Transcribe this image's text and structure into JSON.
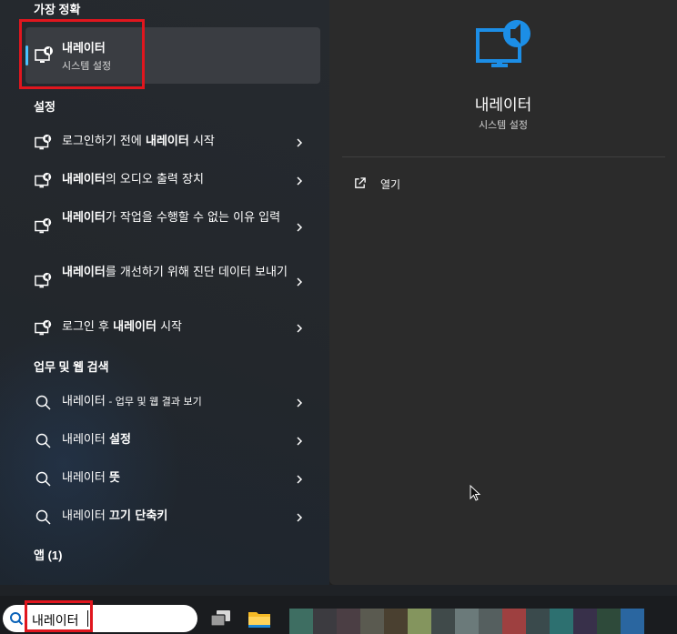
{
  "best_match": {
    "heading": "가장 정확",
    "title": "내레이터",
    "subtitle": "시스템 설정"
  },
  "settings": {
    "heading": "설정",
    "items": [
      {
        "pre": "로그인하기 전에 ",
        "bold": "내레이터",
        "post": " 시작"
      },
      {
        "pre": "",
        "bold": "내레이터",
        "post": "의 오디오 출력 장치"
      },
      {
        "pre": "",
        "bold": "내레이터",
        "post": "가 작업을 수행할 수 없는 이유 입력"
      },
      {
        "pre": "",
        "bold": "내레이터",
        "post": "를 개선하기 위해 진단 데이터 보내기"
      },
      {
        "pre": "로그인 후 ",
        "bold": "내레이터",
        "post": " 시작"
      }
    ]
  },
  "web": {
    "heading": "업무 및 웹 검색",
    "items": [
      {
        "pre": "내레이터",
        "bold": "",
        "post": " - 업무 및 웹 결과 보기"
      },
      {
        "pre": "내레이터 ",
        "bold": "설정",
        "post": ""
      },
      {
        "pre": "내레이터 ",
        "bold": "뜻",
        "post": ""
      },
      {
        "pre": "내레이터 ",
        "bold": "끄기 단축키",
        "post": ""
      }
    ]
  },
  "apps": {
    "heading": "앱 (1)"
  },
  "detail": {
    "title": "내레이터",
    "subtitle": "시스템 설정",
    "open_label": "열기"
  },
  "taskbar": {
    "search_value": "내레이터",
    "swatch_colors": [
      "#3e6e62",
      "#3c3b40",
      "#4b3e44",
      "#5a5a50",
      "#4a4030",
      "#84955e",
      "#404a4a",
      "#6b7a7a",
      "#555f5f",
      "#9e4040",
      "#3a4a4c",
      "#2d7070",
      "#38304a",
      "#2e4a3a",
      "#2a66a0"
    ]
  },
  "colors": {
    "accent": "#4cc2ff",
    "highlight_box": "#e0161e",
    "icon_blue": "#1c8ee6"
  }
}
